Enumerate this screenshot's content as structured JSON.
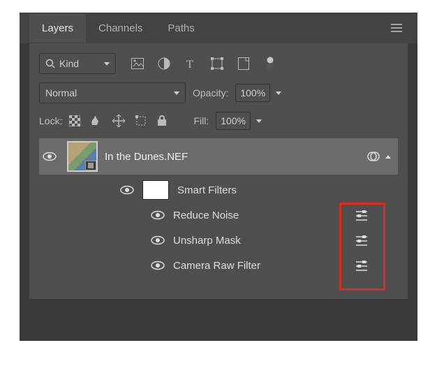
{
  "tabs": {
    "layers": "Layers",
    "channels": "Channels",
    "paths": "Paths"
  },
  "filter_row": {
    "kind_label": "Kind"
  },
  "blend_row": {
    "mode": "Normal",
    "opacity_label": "Opacity:",
    "opacity_value": "100%"
  },
  "lock_row": {
    "lock_label": "Lock:",
    "fill_label": "Fill:",
    "fill_value": "100%"
  },
  "layer": {
    "name": "In the Dunes.NEF"
  },
  "smart_filters": {
    "header": "Smart Filters",
    "items": [
      {
        "name": "Reduce Noise"
      },
      {
        "name": "Unsharp Mask"
      },
      {
        "name": "Camera Raw Filter"
      }
    ]
  }
}
